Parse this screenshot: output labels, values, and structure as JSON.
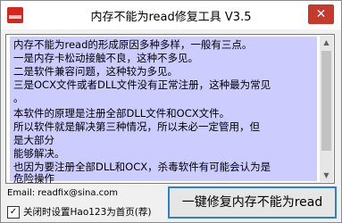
{
  "window": {
    "title": "内存不能为read修复工具 V3.5",
    "close_glyph": "✕"
  },
  "info_text": {
    "lines": [
      "内存不能为read的形成原因多种多样，一般有三点。",
      "一是内存卡松动接触不良，这种不多见。",
      "二是软件兼容问题，这种较为多见。",
      "三是OCX文件或者DLL文件没有正常注册，这种最为常见",
      "。",
      "本软件的原理是注册全部DLL文件和OCX文件。",
      "所以软件就是解决第三种情况，所以未必一定管用，但",
      "是大部分",
      "能够解决。",
      "也因为要注册全部DLL和OCX，杀毒软件有可能会认为是",
      "危险操作"
    ]
  },
  "scrollbar": {
    "up_glyph": "▲",
    "down_glyph": "▼"
  },
  "footer": {
    "email_label": "Email:  readfix@sina.com",
    "checkbox_checked": "✓",
    "checkbox_label": "关闭时设置Hao123为首页(荐)",
    "repair_button": "一键修复内存不能为read"
  }
}
